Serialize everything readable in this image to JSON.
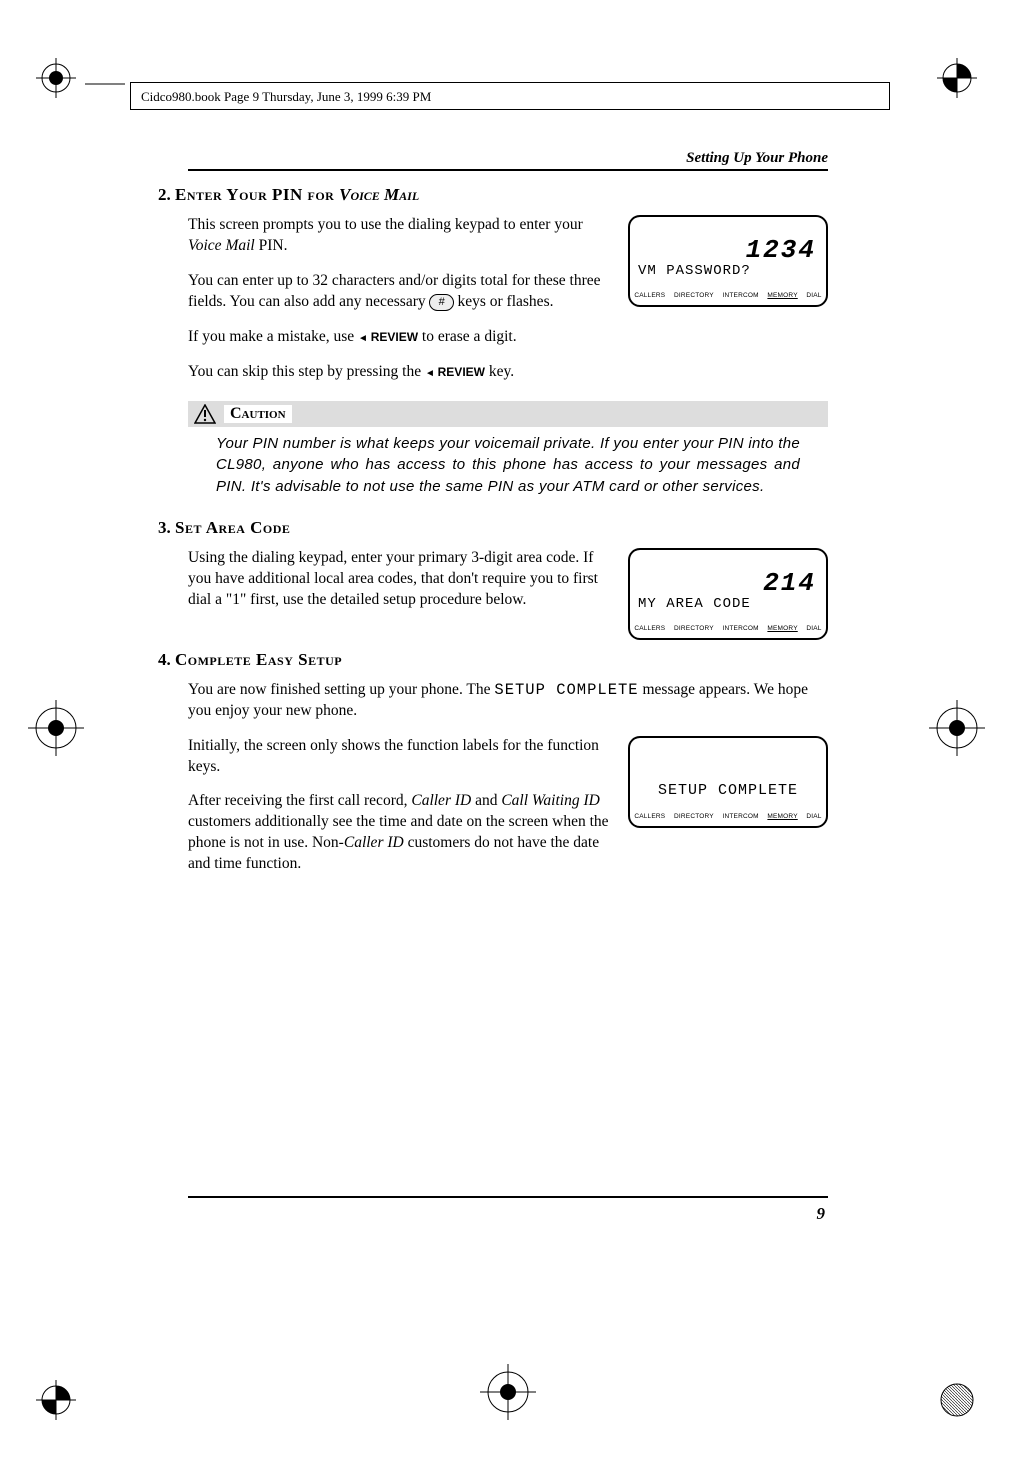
{
  "frame_text": "Cidco980.book  Page 9  Thursday, June 3, 1999  6:39 PM",
  "running_head": "Setting Up Your Phone",
  "page_number": "9",
  "sections": {
    "s2": {
      "title_num": "2.",
      "title_caps": "Enter Your PIN for ",
      "title_ital": "Voice Mail",
      "p1a": "This screen prompts you to use the dialing keypad to enter your ",
      "p1b": "Voice Mail",
      "p1c": " PIN.",
      "p2a": "You can enter up to 32 characters and/or digits total for these three fields. You can also add any necessary ",
      "p2b": " keys or flashes.",
      "hash_key": "#",
      "p3a": "If you make a mistake, use ",
      "review": "REVIEW",
      "p3b": " to erase a digit.",
      "p4a": "You can skip this step by pressing the ",
      "p4b": " key."
    },
    "caution": {
      "label": "Caution",
      "body": "Your PIN number is what keeps your voicemail private. If you enter your PIN into the CL980, anyone who has access to this phone has access to your messages and PIN. It's advisable to not use the same PIN as your ATM card or other services."
    },
    "s3": {
      "title_num": "3.",
      "title_caps": "Set Area Code",
      "p1": "Using the dialing keypad, enter your primary 3-digit area code. If you have additional local area codes, that don't require you to first dial a \"1\" first, use the detailed setup procedure below."
    },
    "s4": {
      "title_num": "4.",
      "title_caps": "Complete Easy Setup",
      "p1a": "You are now finished setting up your phone. The ",
      "p1mono": "SETUP COMPLETE",
      "p1b": " message appears. We hope you enjoy your new phone.",
      "p2": "Initially, the screen only shows the function labels for the function keys.",
      "p3a": "After receiving the first call record, ",
      "p3i1": "Caller ID",
      "p3b": " and ",
      "p3i2": "Call Waiting ID",
      "p3c": " customers additionally see the time and date on the screen when the phone is not in use. Non-",
      "p3i3": "Caller ID",
      "p3d": " customers do not have the date and time function."
    }
  },
  "lcd1": {
    "big": "1234",
    "line2": "VM PASSWORD?",
    "keys": [
      "CALLERS",
      "DIRECTORY",
      "INTERCOM",
      "MEMORY",
      "DIAL"
    ]
  },
  "lcd2": {
    "big": "214",
    "line2": "MY AREA CODE",
    "keys": [
      "CALLERS",
      "DIRECTORY",
      "INTERCOM",
      "MEMORY",
      "DIAL"
    ]
  },
  "lcd3": {
    "line2": "SETUP COMPLETE",
    "keys": [
      "CALLERS",
      "DIRECTORY",
      "INTERCOM",
      "MEMORY",
      "DIAL"
    ]
  }
}
